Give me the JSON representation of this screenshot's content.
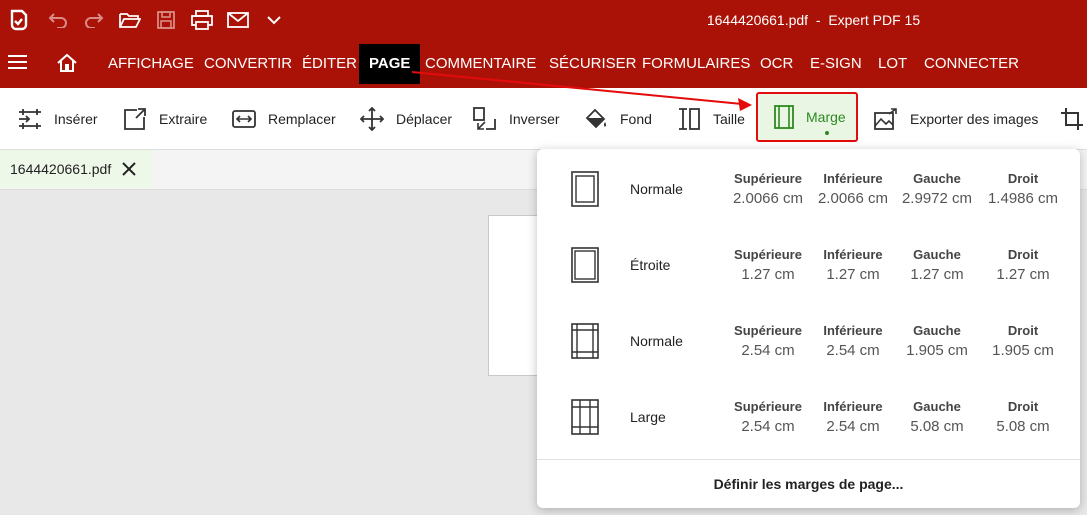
{
  "window": {
    "title": "1644420661.pdf",
    "app_name": "Expert PDF 15",
    "quick_access": [
      "app-logo-icon",
      "undo-icon",
      "redo-icon",
      "open-folder-icon",
      "save-icon",
      "print-icon",
      "email-icon",
      "chevron-down-icon"
    ]
  },
  "menu": {
    "tabs": [
      {
        "label": "AFFICHAGE"
      },
      {
        "label": "CONVERTIR"
      },
      {
        "label": "ÉDITER"
      },
      {
        "label": "PAGE"
      },
      {
        "label": "COMMENTAIRE"
      },
      {
        "label": "SÉCURISER"
      },
      {
        "label": "FORMULAIRES"
      },
      {
        "label": "OCR"
      },
      {
        "label": "E-SIGN"
      },
      {
        "label": "LOT"
      },
      {
        "label": "CONNECTER"
      }
    ],
    "active_tab": "PAGE"
  },
  "ribbon": {
    "buttons": [
      {
        "label": "Insérer",
        "icon": "insert-page-icon"
      },
      {
        "label": "Extraire",
        "icon": "extract-icon"
      },
      {
        "label": "Remplacer",
        "icon": "replace-icon"
      },
      {
        "label": "Déplacer",
        "icon": "move-icon"
      },
      {
        "label": "Inverser",
        "icon": "reverse-icon"
      },
      {
        "label": "Fond",
        "icon": "paint-bucket-icon"
      },
      {
        "label": "Taille",
        "icon": "size-icon"
      },
      {
        "label": "Marge",
        "icon": "margin-icon"
      },
      {
        "label": "Exporter des images",
        "icon": "export-images-icon"
      }
    ],
    "active_button": "Marge"
  },
  "document_tab": {
    "name": "1644420661.pdf"
  },
  "margin_menu": {
    "options": [
      {
        "name": "Normale",
        "top_label": "Supérieure",
        "top": "2.0066 cm",
        "bottom_label": "Inférieure",
        "bottom": "2.0066 cm",
        "left_label": "Gauche",
        "left": "2.9972 cm",
        "right_label": "Droit",
        "right": "1.4986 cm"
      },
      {
        "name": "Étroite",
        "top_label": "Supérieure",
        "top": "1.27 cm",
        "bottom_label": "Inférieure",
        "bottom": "1.27 cm",
        "left_label": "Gauche",
        "left": "1.27 cm",
        "right_label": "Droit",
        "right": "1.27 cm"
      },
      {
        "name": "Normale",
        "top_label": "Supérieure",
        "top": "2.54 cm",
        "bottom_label": "Inférieure",
        "bottom": "2.54 cm",
        "left_label": "Gauche",
        "left": "1.905 cm",
        "right_label": "Droit",
        "right": "1.905 cm"
      },
      {
        "name": "Large",
        "top_label": "Supérieure",
        "top": "2.54 cm",
        "bottom_label": "Inférieure",
        "bottom": "2.54 cm",
        "left_label": "Gauche",
        "left": "5.08 cm",
        "right_label": "Droit",
        "right": "5.08 cm"
      }
    ],
    "define_label": "Définir les marges de page..."
  },
  "colors": {
    "brand_red": "#ab1207",
    "highlight_green": "#2d8a1f",
    "annotation_red": "#e30b0b"
  }
}
